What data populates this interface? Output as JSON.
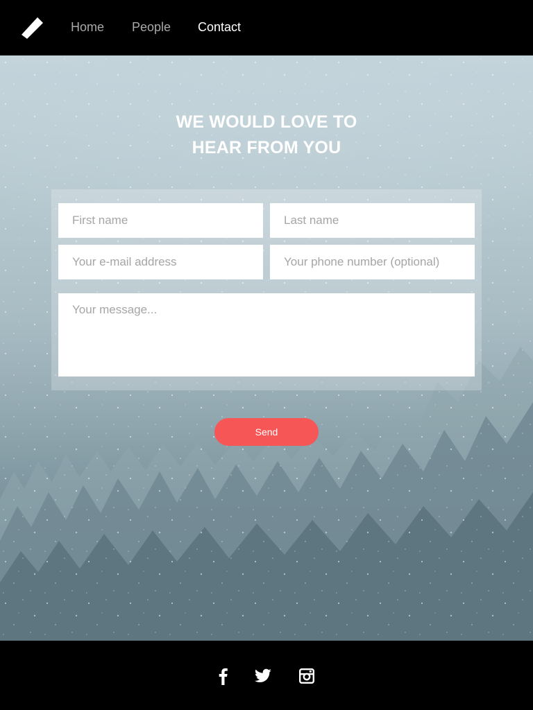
{
  "nav": {
    "logo_icon": "pencil-stroke-icon",
    "items": [
      {
        "label": "Home",
        "active": false
      },
      {
        "label": "People",
        "active": false
      },
      {
        "label": "Contact",
        "active": true
      }
    ]
  },
  "hero": {
    "heading_line1": "WE WOULD LOVE TO",
    "heading_line2": "HEAR FROM YOU"
  },
  "form": {
    "first_name": {
      "value": "",
      "placeholder": "First name"
    },
    "last_name": {
      "value": "",
      "placeholder": "Last name"
    },
    "email": {
      "value": "",
      "placeholder": "Your e-mail address"
    },
    "phone": {
      "value": "",
      "placeholder": "Your phone number (optional)"
    },
    "message": {
      "value": "",
      "placeholder": "Your message..."
    },
    "send_label": "Send"
  },
  "footer": {
    "social": [
      "facebook-icon",
      "twitter-icon",
      "instagram-icon"
    ]
  },
  "colors": {
    "accent": "#f65756",
    "bar_background": "#000000",
    "nav_inactive": "#a9a9a9",
    "nav_active": "#ffffff"
  }
}
